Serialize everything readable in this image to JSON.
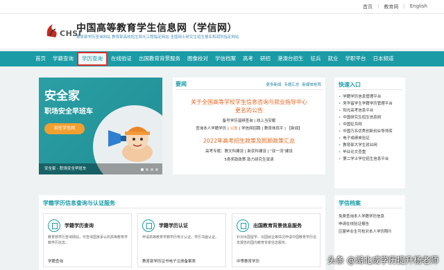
{
  "top_links": [
    "首页",
    "|",
    "教育网",
    "|",
    "English"
  ],
  "site": {
    "logo_text": "CHSI",
    "title": "中国高等教育学生信息网（学信网）",
    "subtitle": "教育部学历查询网站  教育部高校招生阳光工程指定网站  全国硕士研究生招生报名和调剂指定网站"
  },
  "nav": [
    "首页",
    "学籍查询",
    "学历查询",
    "在线验证",
    "出国教育背景服务",
    "图像校对",
    "学信档案",
    "高考",
    "研招",
    "港澳台招生",
    "征兵",
    "就业",
    "学职平台",
    "日本频道"
  ],
  "hero": {
    "title": "安全家",
    "slogan": "职场安全早班车",
    "button": "前往学信网",
    "caption": "安全家 - 职场安全早班车"
  },
  "news": {
    "heading": "要闻",
    "links": [
      "更多新闻",
      "专题汇总",
      "新媒体矩阵"
    ],
    "headline1_a": "关于全国高等学校学生信息咨询与就业指导中心",
    "headline1_b": "更名的公告",
    "line1": "备号学历谐辨查询 | 线上当安眠",
    "line2_a": "查询本人学籍学历 | ",
    "line2_hl": "公告",
    "line2_b": " | 学信网招聘 | 教育体现平 | 【新闻】",
    "headline2": "2022年高考招生政策及照顾政策汇总",
    "line3": "高考专题：教文科建设 | 新农科建设 | \"双一流\"建设",
    "line4": "5类奖助政策 助力研究生就读"
  },
  "quick": {
    "heading": "快速入口",
    "items": [
      "学籍学历信息管理平台",
      "来华留学生学籍学历管理平台",
      "阳光高考信息平台",
      "中国研究生招生信息网",
      "中国征兵网",
      "中国万名优秀创新创业导师库",
      "电子成绩单验证",
      "教育部大学生就业网",
      "毕业论文查重",
      "第二学士学位招生信息平台"
    ]
  },
  "services": {
    "heading": "学籍学历信息查询与认证服务",
    "cards": [
      {
        "title": "学籍学历查询",
        "desc": "教育部学历查询网站，可查询国家承认的高等教育学籍学历信息。",
        "btn": "学籍查询"
      },
      {
        "title": "学籍学历认证",
        "desc": "申请高等教育学籍学历电子认证，学历书面认证。",
        "btn": "教育部学历证书电子注册备案表"
      },
      {
        "title": "出国教育背景信息服务",
        "desc": "针对出国留学、出国就业等情况申请中国教育学历信息报告的国内教育背景信息服务。",
        "btn": "中等教育学历"
      }
    ]
  },
  "info": {
    "heading": "学信档案",
    "items": [
      "免费查询本人学籍学历信息",
      "申请在线验证报告",
      "应届毕业生可校对本人学历照片"
    ]
  },
  "watermark": "头条 @湖北成学历提升杨老师",
  "colors": {
    "primary": "#1a9ba6",
    "accent": "#e0641c",
    "highlight": "#e0302a"
  }
}
